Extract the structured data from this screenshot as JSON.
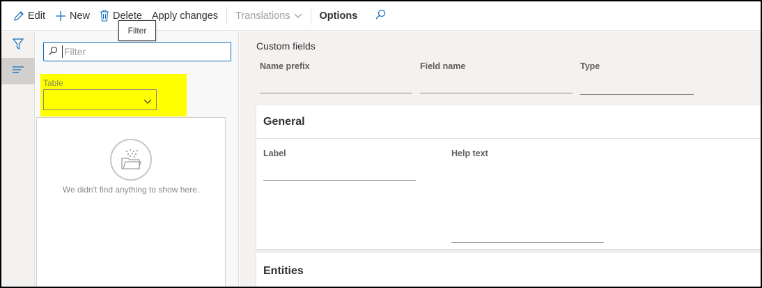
{
  "toolbar": {
    "edit_label": "Edit",
    "new_label": "New",
    "delete_label": "Delete",
    "apply_label": "Apply changes",
    "translations_label": "Translations",
    "options_label": "Options"
  },
  "tooltip": {
    "text": "Filter"
  },
  "filter_pane": {
    "search_placeholder": "Filter",
    "table_label": "Table",
    "table_value": "",
    "empty_message": "We didn't find anything to show here."
  },
  "main": {
    "custom_fields_title": "Custom fields",
    "name_prefix_label": "Name prefix",
    "field_name_label": "Field name",
    "type_label": "Type",
    "general": {
      "title": "General",
      "label_label": "Label",
      "help_text_label": "Help text"
    },
    "entities": {
      "title": "Entities"
    }
  },
  "colors": {
    "highlight": "#ffff00",
    "accent": "#0f6cbd",
    "rail_bg": "#f3f2f1"
  },
  "icons": [
    "edit-icon",
    "plus-icon",
    "trash-icon",
    "chevron-down-icon",
    "search-icon",
    "filter-icon",
    "list-icon",
    "empty-folder-icon"
  ]
}
